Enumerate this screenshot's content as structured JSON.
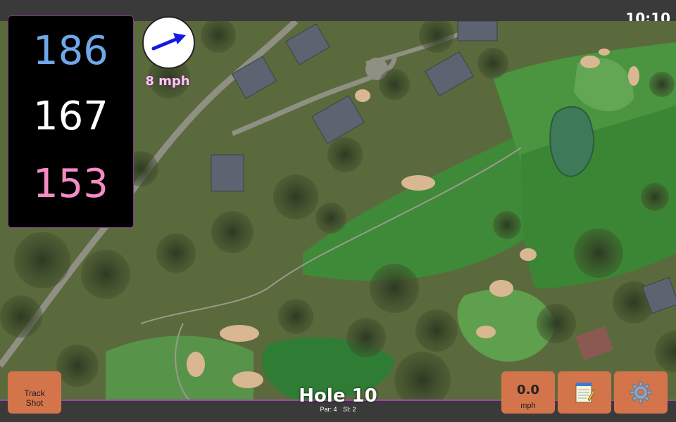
{
  "status": {
    "time": "10:10"
  },
  "distances": {
    "back": "186",
    "middle": "167",
    "front": "153"
  },
  "wind": {
    "speed": "8 mph"
  },
  "hole": {
    "title": "Hole 10",
    "par": "Par: 4",
    "stroke_index": "SI: 2"
  },
  "buttons": {
    "track_shot_line1": "Track",
    "track_shot_line2": "Shot",
    "speed_value": "0.0",
    "speed_unit": "mph",
    "notes_icon": "notepad-icon",
    "settings_icon": "gear-icon"
  },
  "colors": {
    "back_distance": "#6fa8e9",
    "middle_distance": "#ffffff",
    "front_distance": "#f58cc6",
    "button": "#d4744a",
    "accent": "#b25bb8",
    "wind_arrow": "#1419e6"
  }
}
